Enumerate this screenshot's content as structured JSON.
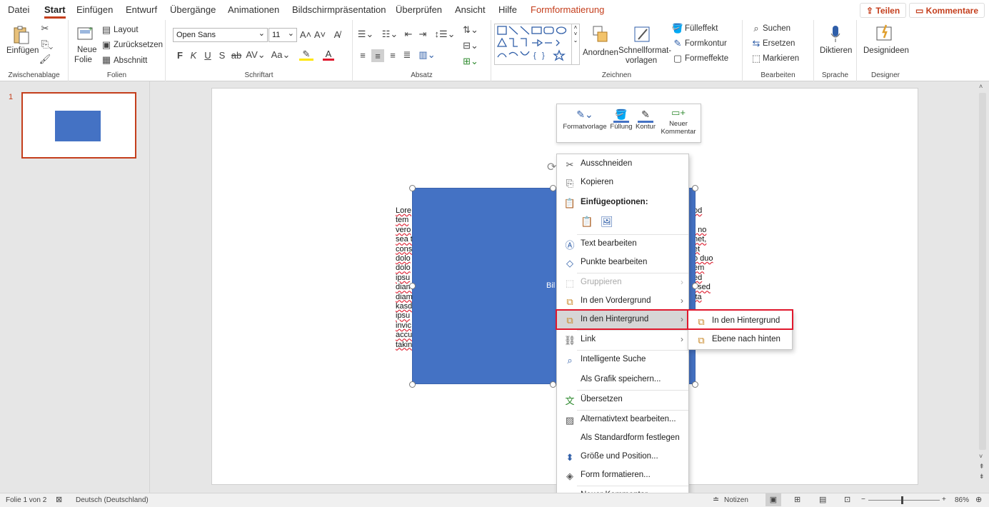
{
  "tabs": [
    "Datei",
    "Start",
    "Einfügen",
    "Entwurf",
    "Übergänge",
    "Animationen",
    "Bildschirmpräsentation",
    "Überprüfen",
    "Ansicht",
    "Hilfe",
    "Formformatierung"
  ],
  "share_label": "Teilen",
  "comments_label": "Kommentare",
  "ribbon": {
    "clipboard": {
      "label": "Zwischenablage",
      "paste": "Einfügen"
    },
    "slides": {
      "label": "Folien",
      "new_slide_1": "Neue",
      "new_slide_2": "Folie",
      "layout": "Layout",
      "reset": "Zurücksetzen",
      "section": "Abschnitt"
    },
    "font": {
      "label": "Schriftart",
      "font_name": "Open Sans",
      "font_size": "11",
      "bold": "F",
      "italic": "K",
      "underline": "U",
      "strike": "S"
    },
    "paragraph": {
      "label": "Absatz"
    },
    "drawing": {
      "label": "Zeichnen",
      "arrange_1": "Anordnen",
      "quickstyles_1": "Schnellformat-",
      "quickstyles_2": "vorlagen",
      "fill": "Fülleffekt",
      "outline": "Formkontur",
      "effects": "Formeffekte"
    },
    "editing": {
      "label": "Bearbeiten",
      "find": "Suchen",
      "replace": "Ersetzen",
      "select": "Markieren"
    },
    "voice": {
      "label": "Sprache",
      "dictate": "Diktieren"
    },
    "designer": {
      "label": "Designer",
      "ideas": "Designideen"
    }
  },
  "thumbnail_number": "1",
  "slide": {
    "lorem_left": [
      "Lore",
      "tem",
      "vero",
      "sea t",
      "cons",
      "dolo",
      "dolo",
      "ipsu",
      "diam",
      "diam",
      "kasd",
      "ipsu",
      "invic",
      "accu",
      "takin"
    ],
    "lorem_right": [
      "od",
      "t",
      ", no",
      "net,",
      "et",
      "o duo",
      "em",
      "ed",
      ", sed",
      "ita",
      "",
      "",
      "",
      "",
      ""
    ],
    "shape_text": "Bil"
  },
  "minibar": {
    "style": "Formatvorlage",
    "fill": "Füllung",
    "outline": "Kontur",
    "comment_1": "Neuer",
    "comment_2": "Kommentar"
  },
  "context_menu": {
    "cut": "Ausschneiden",
    "copy": "Kopieren",
    "paste_options": "Einfügeoptionen:",
    "edit_text": "Text bearbeiten",
    "edit_points": "Punkte bearbeiten",
    "group": "Gruppieren",
    "bring_forward": "In den Vordergrund",
    "send_backward": "In den Hintergrund",
    "link": "Link",
    "smart_lookup": "Intelligente Suche",
    "save_as_picture": "Als Grafik speichern...",
    "translate": "Übersetzen",
    "alt_text": "Alternativtext bearbeiten...",
    "set_default": "Als Standardform festlegen",
    "size_position": "Größe und Position...",
    "format_shape": "Form formatieren...",
    "new_comment": "Neuer Kommentar"
  },
  "submenu": {
    "send_to_back": "In den Hintergrund",
    "send_backward": "Ebene nach hinten"
  },
  "status": {
    "slide_info": "Folie 1 von 2",
    "language": "Deutsch (Deutschland)",
    "notes": "Notizen",
    "zoom": "86%"
  },
  "colors": {
    "accent": "#c43e1c",
    "shape": "#4472c4",
    "highlight_red": "#e0182d"
  }
}
